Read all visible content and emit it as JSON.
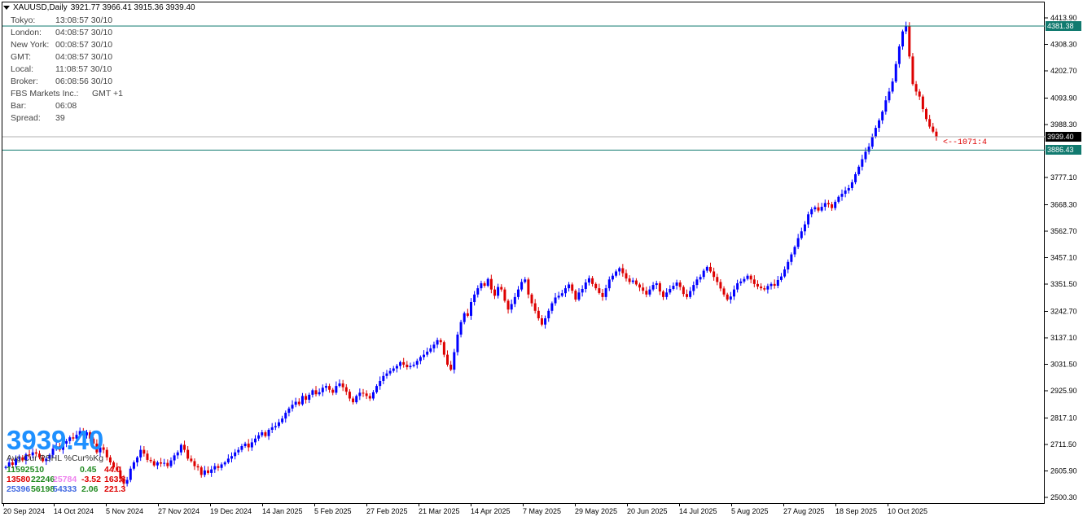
{
  "header": {
    "symbol_tf": "XAUUSD,Daily",
    "ohlc": "3921.77 3966.41 3915.36 3939.40"
  },
  "clock_panel": [
    {
      "label": "Tokyo:",
      "value": "13:08:57  30/10"
    },
    {
      "label": "London:",
      "value": "04:08:57  30/10"
    },
    {
      "label": "New York:",
      "value": "00:08:57  30/10"
    },
    {
      "label": "GMT:",
      "value": "04:08:57  30/10"
    },
    {
      "label": "Local:",
      "value": "11:08:57  30/10"
    },
    {
      "label": "Broker:",
      "value": "06:08:56  30/10"
    },
    {
      "label": "FBS Markets Inc.:",
      "value": "GMT +1"
    },
    {
      "label": "Bar:",
      "value": "06:08"
    },
    {
      "label": "Spread:",
      "value": "39"
    }
  ],
  "hud": {
    "big_price": "3939.40",
    "header": "Avg  Cur  PSHL %Cur%Kg",
    "rows": [
      {
        "a": "11592510",
        "a_color": "#228b22",
        "b": "",
        "b_color": "#228b22",
        "c": "0.45",
        "c_color": "#228b22",
        "d": "44.0",
        "d_color": "#dd0000"
      },
      {
        "a": "13580",
        "a_color": "#dd0000",
        "b": "22246",
        "b_color": "#228b22",
        "c": "25784",
        "c_color": "#ee82ee",
        "e": "-3.52",
        "e_color": "#dd0000",
        "d": "163.8",
        "d_color": "#dd0000"
      },
      {
        "a": "25396",
        "a_color": "#4169e1",
        "b": "56198",
        "b_color": "#228b22",
        "c": "54333",
        "c_color": "#4169e1",
        "e": "2.06",
        "e_color": "#228b22",
        "d": "221.3",
        "d_color": "#dd0000"
      }
    ]
  },
  "annotation": {
    "text": "<--1071:4",
    "color": "#dd0000"
  },
  "axis": {
    "y_ticks": [
      "4413.90",
      "4308.30",
      "4202.70",
      "4093.90",
      "3988.30",
      "3777.10",
      "3668.30",
      "3562.70",
      "3457.10",
      "3351.50",
      "3242.70",
      "3137.10",
      "3031.50",
      "2925.90",
      "2817.10",
      "2711.50",
      "2605.90",
      "2500.30"
    ],
    "x_ticks": [
      "20 Sep 2024",
      "14 Oct 2024",
      "5 Nov 2024",
      "27 Nov 2024",
      "19 Dec 2024",
      "14 Jan 2025",
      "5 Feb 2025",
      "27 Feb 2025",
      "21 Mar 2025",
      "14 Apr 2025",
      "7 May 2025",
      "29 May 2025",
      "20 Jun 2025",
      "14 Jul 2025",
      "5 Aug 2025",
      "27 Aug 2025",
      "18 Sep 2025",
      "10 Oct 2025"
    ],
    "price_tags": [
      {
        "value": "4381.38",
        "kind": "hline",
        "bg": "#117a6f",
        "fg": "#ffffff"
      },
      {
        "value": "3939.40",
        "kind": "bid",
        "bg": "#000000",
        "fg": "#ffffff"
      },
      {
        "value": "3886.43",
        "kind": "hline",
        "bg": "#117a6f",
        "fg": "#ffffff"
      }
    ]
  },
  "chart_data": {
    "type": "candlestick",
    "bull_color": "#0000ff",
    "bear_color": "#dd0000",
    "ylim": [
      2500.3,
      4413.9
    ],
    "hlines": [
      4381.38,
      3886.43
    ],
    "bid": 3939.4,
    "closes": [
      2622,
      2640,
      2630,
      2655,
      2660,
      2648,
      2672,
      2668,
      2680,
      2675,
      2660,
      2645,
      2655,
      2670,
      2695,
      2705,
      2690,
      2715,
      2725,
      2740,
      2735,
      2750,
      2765,
      2748,
      2760,
      2735,
      2715,
      2680,
      2700,
      2690,
      2660,
      2640,
      2620,
      2608,
      2575,
      2555,
      2570,
      2615,
      2640,
      2660,
      2690,
      2675,
      2650,
      2645,
      2628,
      2640,
      2635,
      2638,
      2625,
      2648,
      2668,
      2680,
      2710,
      2690,
      2655,
      2645,
      2625,
      2620,
      2590,
      2608,
      2598,
      2612,
      2625,
      2618,
      2632,
      2640,
      2655,
      2665,
      2680,
      2690,
      2705,
      2715,
      2700,
      2720,
      2735,
      2748,
      2760,
      2745,
      2770,
      2780,
      2785,
      2800,
      2815,
      2838,
      2855,
      2870,
      2882,
      2872,
      2905,
      2890,
      2910,
      2928,
      2912,
      2920,
      2938,
      2945,
      2930,
      2918,
      2945,
      2955,
      2940,
      2922,
      2895,
      2880,
      2905,
      2918,
      2915,
      2905,
      2895,
      2920,
      2945,
      2965,
      2985,
      2995,
      3005,
      3015,
      3025,
      3040,
      3030,
      3020,
      3025,
      3030,
      3045,
      3060,
      3070,
      3082,
      3095,
      3110,
      3128,
      3120,
      3070,
      3030,
      3010,
      3080,
      3150,
      3200,
      3235,
      3225,
      3280,
      3310,
      3335,
      3355,
      3345,
      3372,
      3330,
      3305,
      3340,
      3330,
      3285,
      3250,
      3272,
      3300,
      3330,
      3360,
      3370,
      3310,
      3275,
      3245,
      3215,
      3190,
      3215,
      3245,
      3275,
      3298,
      3305,
      3315,
      3335,
      3350,
      3325,
      3290,
      3318,
      3332,
      3358,
      3375,
      3352,
      3335,
      3316,
      3300,
      3335,
      3370,
      3385,
      3402,
      3415,
      3395,
      3374,
      3360,
      3366,
      3350,
      3338,
      3325,
      3310,
      3330,
      3348,
      3355,
      3322,
      3300,
      3318,
      3332,
      3345,
      3358,
      3340,
      3312,
      3300,
      3324,
      3348,
      3370,
      3380,
      3405,
      3420,
      3402,
      3380,
      3360,
      3334,
      3310,
      3290,
      3302,
      3330,
      3355,
      3362,
      3372,
      3385,
      3370,
      3352,
      3342,
      3335,
      3330,
      3344,
      3352,
      3345,
      3368,
      3382,
      3410,
      3440,
      3470,
      3500,
      3535,
      3562,
      3590,
      3630,
      3650,
      3658,
      3645,
      3660,
      3675,
      3670,
      3655,
      3680,
      3700,
      3712,
      3725,
      3735,
      3758,
      3790,
      3820,
      3850,
      3880,
      3900,
      3940,
      3975,
      4005,
      4040,
      4085,
      4120,
      4160,
      4230,
      4300,
      4360,
      4381,
      4260,
      4150,
      4120,
      4100,
      4050,
      4010,
      3980,
      3960,
      3939
    ]
  }
}
